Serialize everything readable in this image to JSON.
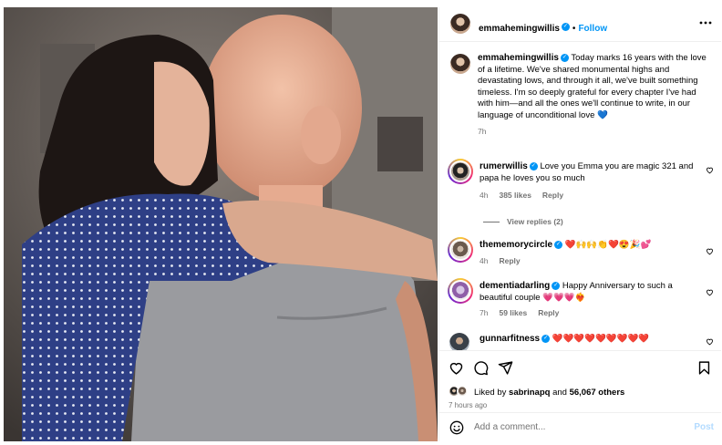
{
  "header": {
    "username": "emmahemingwillis",
    "separator": "•",
    "follow_label": "Follow",
    "more_icon": "more-horizontal-icon"
  },
  "caption": {
    "username": "emmahemingwillis",
    "text": "Today marks 16 years with the love of a lifetime. We've shared monumental highs and devastating lows, and through it all, we've built something timeless. I'm so deeply grateful for every chapter I've had with him—and all the ones we'll continue to write, in our language of unconditional love 💙",
    "time": "7h"
  },
  "comments": [
    {
      "username": "rumerwillis",
      "text": "Love you Emma you are magic 321 and papa he loves you so much",
      "time": "4h",
      "likes": "385 likes",
      "reply": "Reply"
    },
    {
      "username": "thememorycircle",
      "text": "❤️🙌🙌👏❤️😍🎉💕",
      "time": "4h",
      "likes": "",
      "reply": "Reply"
    },
    {
      "username": "dementiadarling",
      "text": "Happy Anniversary to such a beautiful couple 💗💗💗❤️‍🔥",
      "time": "7h",
      "likes": "59 likes",
      "reply": "Reply"
    },
    {
      "username": "gunnarfitness",
      "text": "❤️❤️❤️❤️❤️❤️❤️❤️❤️",
      "time": "",
      "likes": "",
      "reply": ""
    }
  ],
  "view_replies": "View replies (2)",
  "likes_line": {
    "prefix": "Liked by",
    "user": "sabrinapq",
    "middle": "and",
    "count": "56,067 others"
  },
  "post_time": "7 hours ago",
  "add_comment": {
    "placeholder": "Add a comment...",
    "post_label": "Post"
  },
  "icons": {
    "like": "heart-icon",
    "comment": "comment-icon",
    "share": "share-icon",
    "save": "bookmark-icon",
    "emoji": "emoji-icon"
  },
  "colors": {
    "accent": "#0095f6",
    "muted": "#737373",
    "post_disabled": "#b3dbff"
  }
}
